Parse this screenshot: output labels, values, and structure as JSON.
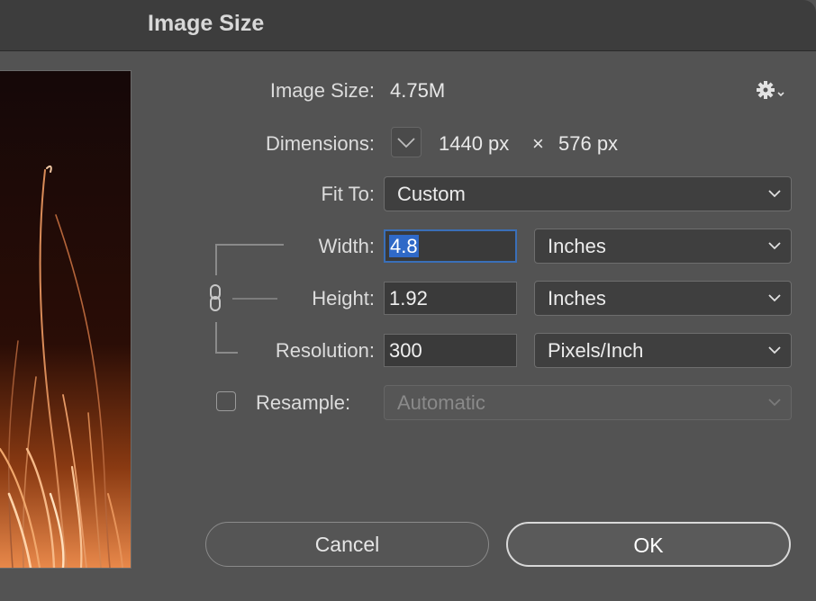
{
  "window": {
    "title": "Image Size"
  },
  "info": {
    "image_size_label": "Image Size:",
    "image_size_value": "4.75M",
    "dimensions_label": "Dimensions:",
    "dim_width": "1440 px",
    "dim_times": "×",
    "dim_height": "576 px"
  },
  "fit_to": {
    "label": "Fit To:",
    "value": "Custom"
  },
  "width": {
    "label": "Width:",
    "value": "4.8",
    "unit": "Inches"
  },
  "height": {
    "label": "Height:",
    "value": "1.92",
    "unit": "Inches"
  },
  "resolution": {
    "label": "Resolution:",
    "value": "300",
    "unit": "Pixels/Inch"
  },
  "resample": {
    "label": "Resample:",
    "checked": false,
    "value": "Automatic"
  },
  "buttons": {
    "cancel": "Cancel",
    "ok": "OK"
  },
  "colors": {
    "background": "#535353",
    "focus": "#3a6fb8",
    "selection": "#2f69c7"
  },
  "icons": {
    "gear": "gear-icon",
    "chain": "chain-link-icon",
    "chevron": "chevron-down-icon"
  }
}
